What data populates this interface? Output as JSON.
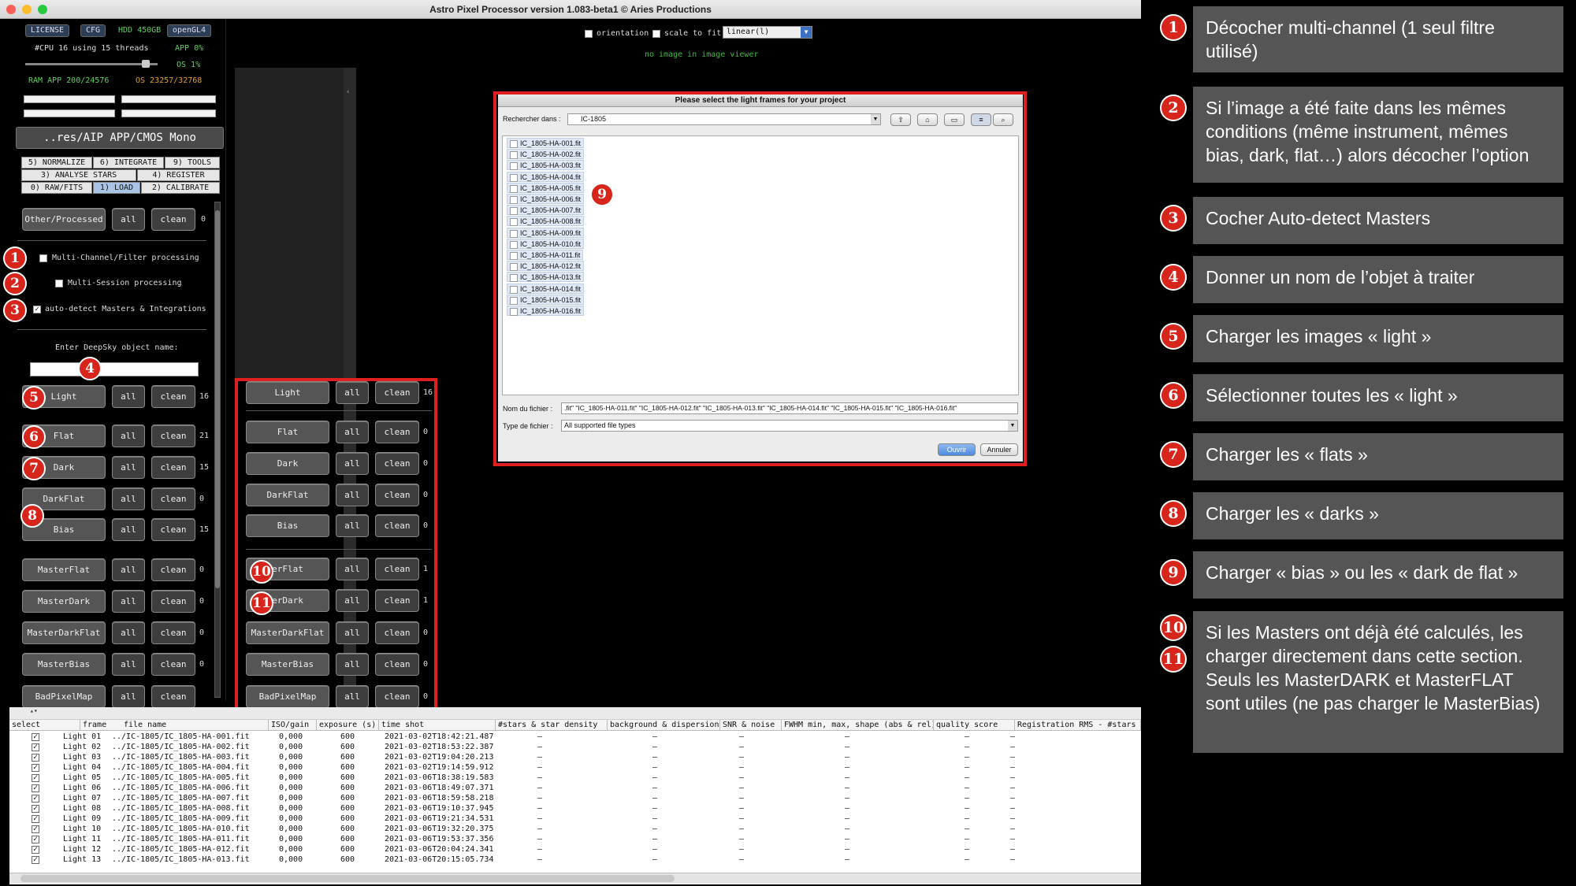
{
  "window": {
    "title": "Astro Pixel Processor version 1.083-beta1 © Aries Productions"
  },
  "topbar": {
    "license": "LICENSE",
    "cfg": "CFG",
    "hdd": "HDD 450GB",
    "opengl": "openGL4",
    "cpu": "#CPU 16  using 15 threads",
    "app_pct": "APP 0%",
    "os_pct": "OS 1%",
    "ram": "RAM  APP 200/24576",
    "os_ram": "OS 23257/32768",
    "orientation": "orientation",
    "scale_to_fit": "scale to fit",
    "stretch": "linear(l)",
    "no_image": "no image in image viewer"
  },
  "path_button": "..res/AIP APP/CMOS Mono",
  "tabs": [
    {
      "label": "5) NORMALIZE"
    },
    {
      "label": "6) INTEGRATE"
    },
    {
      "label": "9) TOOLS"
    },
    {
      "label": "3) ANALYSE STARS"
    },
    {
      "label": "4) REGISTER"
    },
    {
      "label": "0) RAW/FITS"
    },
    {
      "label": "1) LOAD"
    },
    {
      "label": "2) CALIBRATE"
    }
  ],
  "left": {
    "other": {
      "label": "Other/Processed",
      "all": "all",
      "clean": "clean",
      "count": "0"
    },
    "multi_channel": "Multi-Channel/Filter processing",
    "multi_session": "Multi-Session processing",
    "auto_detect": "auto-detect Masters & Integrations",
    "enter_name": "Enter DeepSky object name:",
    "rows": [
      {
        "label": "Light",
        "all": "all",
        "clean": "clean",
        "count": "16"
      },
      {
        "label": "Flat",
        "all": "all",
        "clean": "clean",
        "count": "21"
      },
      {
        "label": "Dark",
        "all": "all",
        "clean": "clean",
        "count": "15"
      },
      {
        "label": "DarkFlat",
        "all": "all",
        "clean": "clean",
        "count": "0"
      },
      {
        "label": "Bias",
        "all": "all",
        "clean": "clean",
        "count": "15"
      },
      {
        "label": "MasterFlat",
        "all": "all",
        "clean": "clean",
        "count": "0"
      },
      {
        "label": "MasterDark",
        "all": "all",
        "clean": "clean",
        "count": "0"
      },
      {
        "label": "MasterDarkFlat",
        "all": "all",
        "clean": "clean",
        "count": "0"
      },
      {
        "label": "MasterBias",
        "all": "all",
        "clean": "clean",
        "count": "0"
      },
      {
        "label": "BadPixelMap",
        "all": "all",
        "clean": "clean",
        "count": ""
      }
    ]
  },
  "zoom": {
    "rows": [
      {
        "label": "Light",
        "all": "all",
        "clean": "clean",
        "count": "16"
      },
      {
        "label": "Flat",
        "all": "all",
        "clean": "clean",
        "count": "0"
      },
      {
        "label": "Dark",
        "all": "all",
        "clean": "clean",
        "count": "0"
      },
      {
        "label": "DarkFlat",
        "all": "all",
        "clean": "clean",
        "count": "0"
      },
      {
        "label": "Bias",
        "all": "all",
        "clean": "clean",
        "count": "0"
      },
      {
        "label": "erFlat",
        "all": "all",
        "clean": "clean",
        "count": "1"
      },
      {
        "label": "erDark",
        "all": "all",
        "clean": "clean",
        "count": "1"
      },
      {
        "label": "MasterDarkFlat",
        "all": "all",
        "clean": "clean",
        "count": "0"
      },
      {
        "label": "MasterBias",
        "all": "all",
        "clean": "clean",
        "count": "0"
      },
      {
        "label": "BadPixelMap",
        "all": "all",
        "clean": "clean",
        "count": "0"
      }
    ]
  },
  "dialog": {
    "title": "Please select the light frames for your project",
    "look_in_label": "Rechercher dans :",
    "look_in_value": "IC-1805",
    "files": [
      "IC_1805-HA-001.fit",
      "IC_1805-HA-002.fit",
      "IC_1805-HA-003.fit",
      "IC_1805-HA-004.fit",
      "IC_1805-HA-005.fit",
      "IC_1805-HA-006.fit",
      "IC_1805-HA-007.fit",
      "IC_1805-HA-008.fit",
      "IC_1805-HA-009.fit",
      "IC_1805-HA-010.fit",
      "IC_1805-HA-011.fit",
      "IC_1805-HA-012.fit",
      "IC_1805-HA-013.fit",
      "IC_1805-HA-014.fit",
      "IC_1805-HA-015.fit",
      "IC_1805-HA-016.fit"
    ],
    "filename_label": "Nom du fichier :",
    "filename_value": ".fit\" \"IC_1805-HA-011.fit\" \"IC_1805-HA-012.fit\" \"IC_1805-HA-013.fit\" \"IC_1805-HA-014.fit\" \"IC_1805-HA-015.fit\" \"IC_1805-HA-016.fit\"",
    "filetype_label": "Type de fichier :",
    "filetype_value": "All supported file types",
    "open": "Ouvrir",
    "cancel": "Annuler"
  },
  "table": {
    "headers": [
      "select",
      "frame",
      "file name",
      "ISO/gain",
      "exposure (s)",
      "time shot",
      "#stars & star density",
      "background & dispersion",
      "SNR & noise",
      "FWHM min, max, shape (abs & rel)",
      "quality score",
      "Registration RMS - #stars"
    ],
    "rows": [
      {
        "frame": "Light 01",
        "file": "../IC-1805/IC_1805-HA-001.fit",
        "iso": "0,000",
        "exp": "600",
        "time": "2021-03-02T18:42:21.487"
      },
      {
        "frame": "Light 02",
        "file": "../IC-1805/IC_1805-HA-002.fit",
        "iso": "0,000",
        "exp": "600",
        "time": "2021-03-02T18:53:22.387"
      },
      {
        "frame": "Light 03",
        "file": "../IC-1805/IC_1805-HA-003.fit",
        "iso": "0,000",
        "exp": "600",
        "time": "2021-03-02T19:04:20.213"
      },
      {
        "frame": "Light 04",
        "file": "../IC-1805/IC_1805-HA-004.fit",
        "iso": "0,000",
        "exp": "600",
        "time": "2021-03-02T19:14:59.912"
      },
      {
        "frame": "Light 05",
        "file": "../IC-1805/IC_1805-HA-005.fit",
        "iso": "0,000",
        "exp": "600",
        "time": "2021-03-06T18:38:19.583"
      },
      {
        "frame": "Light 06",
        "file": "../IC-1805/IC_1805-HA-006.fit",
        "iso": "0,000",
        "exp": "600",
        "time": "2021-03-06T18:49:07.371"
      },
      {
        "frame": "Light 07",
        "file": "../IC-1805/IC_1805-HA-007.fit",
        "iso": "0,000",
        "exp": "600",
        "time": "2021-03-06T18:59:58.218"
      },
      {
        "frame": "Light 08",
        "file": "../IC-1805/IC_1805-HA-008.fit",
        "iso": "0,000",
        "exp": "600",
        "time": "2021-03-06T19:10:37.945"
      },
      {
        "frame": "Light 09",
        "file": "../IC-1805/IC_1805-HA-009.fit",
        "iso": "0,000",
        "exp": "600",
        "time": "2021-03-06T19:21:34.531"
      },
      {
        "frame": "Light 10",
        "file": "../IC-1805/IC_1805-HA-010.fit",
        "iso": "0,000",
        "exp": "600",
        "time": "2021-03-06T19:32:20.375"
      },
      {
        "frame": "Light 11",
        "file": "../IC-1805/IC_1805-HA-011.fit",
        "iso": "0,000",
        "exp": "600",
        "time": "2021-03-06T19:53:37.356"
      },
      {
        "frame": "Light 12",
        "file": "../IC-1805/IC_1805-HA-012.fit",
        "iso": "0,000",
        "exp": "600",
        "time": "2021-03-06T20:04:24.341"
      },
      {
        "frame": "Light 13",
        "file": "../IC-1805/IC_1805-HA-013.fit",
        "iso": "0,000",
        "exp": "600",
        "time": "2021-03-06T20:15:05.734"
      }
    ],
    "dash": "–"
  },
  "badges": [
    "1",
    "2",
    "3",
    "4",
    "5",
    "6",
    "7",
    "8",
    "9",
    "10",
    "11"
  ],
  "legend": [
    {
      "n": "1",
      "text": "Décocher multi-channel (1 seul filtre utilisé)"
    },
    {
      "n": "2",
      "text": "Si l’image a été faite dans les mêmes conditions (même instrument, mêmes bias, dark, flat…) alors décocher l’option"
    },
    {
      "n": "3",
      "text": "Cocher Auto-detect Masters"
    },
    {
      "n": "4",
      "text": "Donner un nom de l’objet à traiter"
    },
    {
      "n": "5",
      "text": "Charger les images « light »"
    },
    {
      "n": "6",
      "text": "Sélectionner toutes les « light »"
    },
    {
      "n": "7",
      "text": "Charger les « flats »"
    },
    {
      "n": "8",
      "text": "Charger les « darks »"
    },
    {
      "n": "9",
      "text": "Charger « bias » ou les « dark de flat »"
    },
    {
      "n": "10",
      "n2": "11",
      "text": "Si les Masters ont déjà été calculés, les charger directement dans cette section. Seuls les MasterDARK et MasterFLAT sont utiles (ne pas charger le MasterBias)"
    }
  ],
  "colors": {
    "annotation_red": "#d8251c",
    "legend_bg": "#555555",
    "active_tab": "#a9c4e6"
  }
}
